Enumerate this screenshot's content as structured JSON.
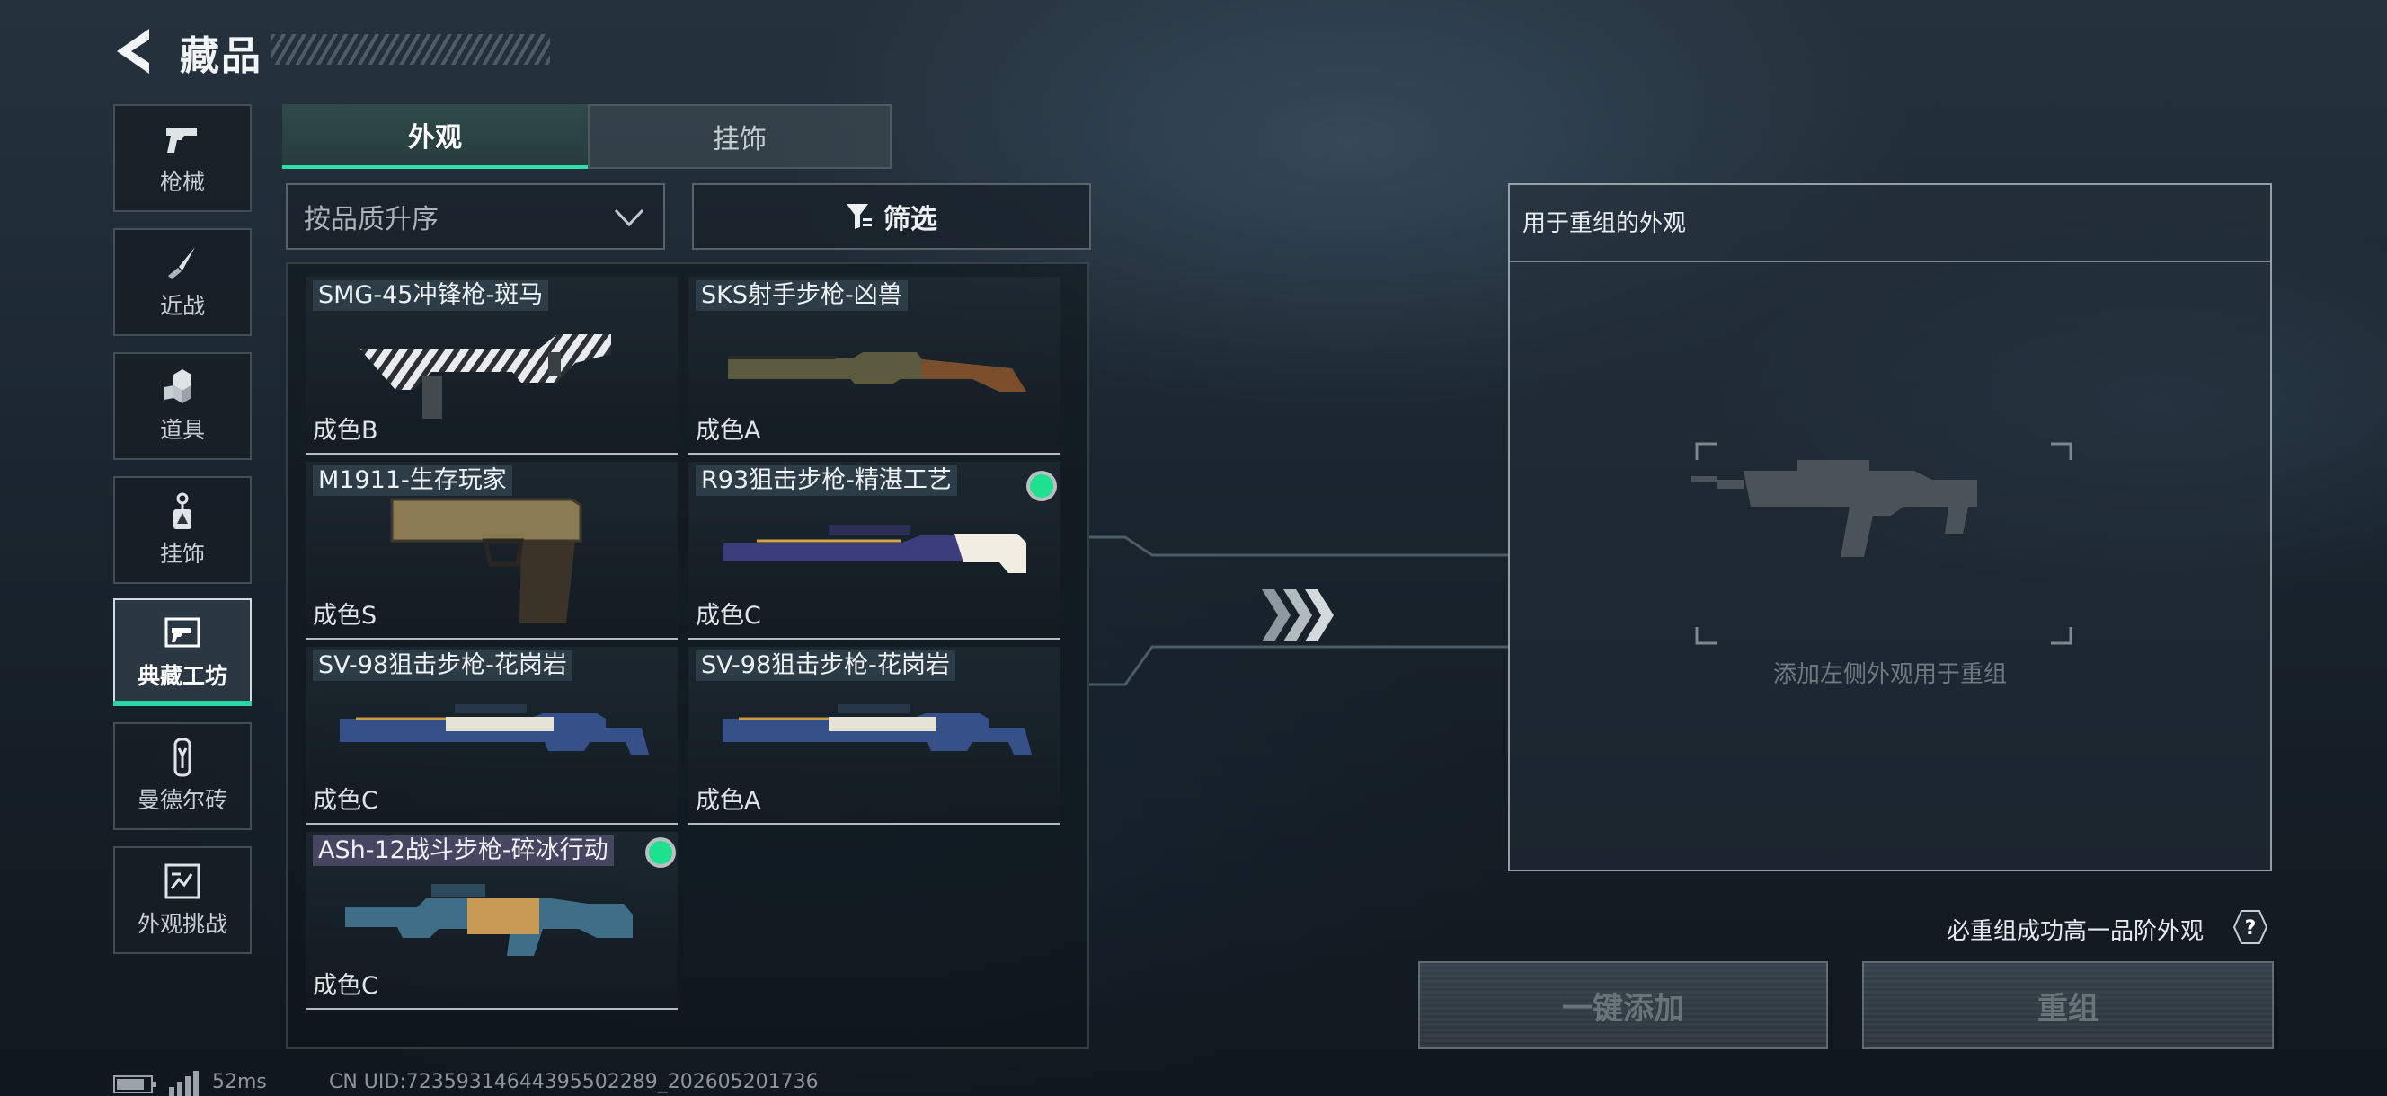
{
  "header": {
    "title": "藏品"
  },
  "sidebar": {
    "items": [
      {
        "label": "枪械",
        "icon": "pistol-icon"
      },
      {
        "label": "近战",
        "icon": "knife-icon"
      },
      {
        "label": "道具",
        "icon": "grenade-icon"
      },
      {
        "label": "挂饰",
        "icon": "keychain-icon"
      },
      {
        "label": "典藏工坊",
        "icon": "workshop-icon",
        "active": true
      },
      {
        "label": "曼德尔砖",
        "icon": "brick-icon"
      },
      {
        "label": "外观挑战",
        "icon": "challenge-icon"
      }
    ]
  },
  "tabs": [
    {
      "label": "外观",
      "active": true
    },
    {
      "label": "挂饰",
      "active": false
    }
  ],
  "filters": {
    "sort_value": "按品质升序",
    "filter_label": "筛选"
  },
  "items": [
    {
      "name": "SMG-45冲锋枪-斑马",
      "grade": "成色B",
      "new": false
    },
    {
      "name": "SKS射手步枪-凶兽",
      "grade": "成色A",
      "new": false
    },
    {
      "name": "M1911-生存玩家",
      "grade": "成色S",
      "new": false
    },
    {
      "name": "R93狙击步枪-精湛工艺",
      "grade": "成色C",
      "new": true
    },
    {
      "name": "SV-98狙击步枪-花岗岩",
      "grade": "成色C",
      "new": false
    },
    {
      "name": "SV-98狙击步枪-花岗岩",
      "grade": "成色A",
      "new": false
    },
    {
      "name": "ASh-12战斗步枪-碎冰行动",
      "grade": "成色C",
      "new": true
    }
  ],
  "reassemble": {
    "panel_title": "用于重组的外观",
    "hint": "添加左侧外观用于重组",
    "note": "必重组成功高一品阶外观",
    "help_glyph": "?",
    "one_click_add_label": "一键添加",
    "reassemble_label": "重组"
  },
  "status": {
    "ping": "52ms",
    "uid": "CN UID:7235931464439550228​9_202605201736"
  },
  "colors": {
    "accent": "#2fe0a8",
    "new_dot": "#1fe08f"
  }
}
